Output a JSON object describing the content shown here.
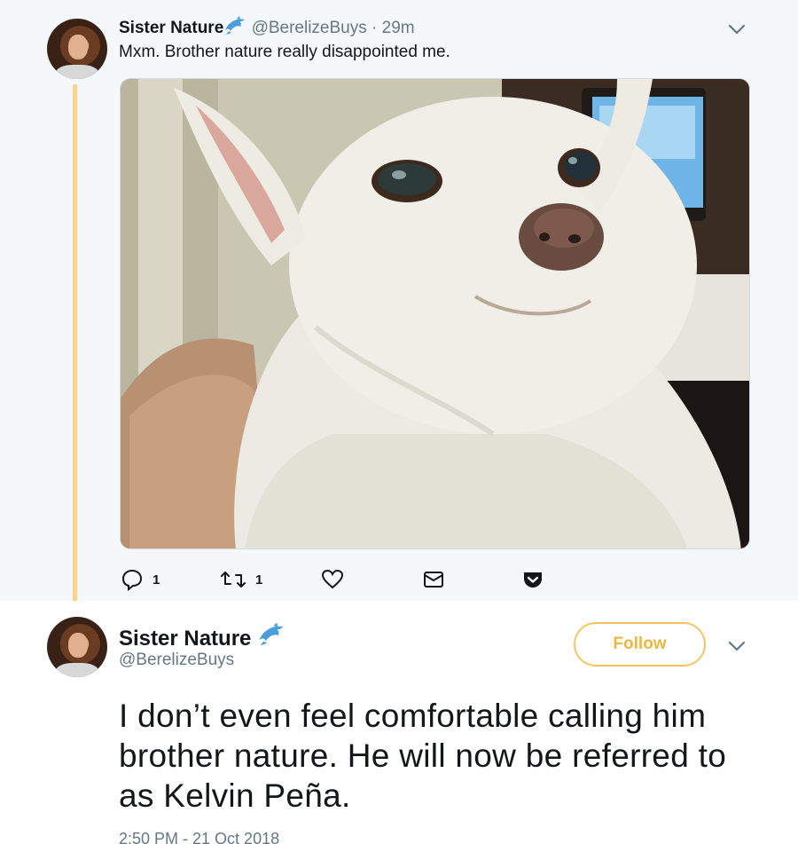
{
  "colors": {
    "accent": "#f0b541",
    "thread_line": "#fcd38c",
    "secondary_text": "#657786",
    "bg_parent": "#f5f8fa"
  },
  "parent_tweet": {
    "display_name": "Sister Nature",
    "handle": "@BerelizeBuys",
    "separator": "·",
    "time": "29m",
    "text": "Mxm. Brother nature really disappointed me.",
    "verified_badge_icon": "dolphin-emoji",
    "actions": {
      "reply_count": "1",
      "retweet_count": "1"
    }
  },
  "main_tweet": {
    "display_name": "Sister Nature",
    "handle": "@BerelizeBuys",
    "follow_label": "Follow",
    "text": "I don’t even feel comfortable calling him brother nature. He will now be referred to as Kelvin Peña.",
    "timestamp": "2:50 PM - 21 Oct 2018"
  }
}
